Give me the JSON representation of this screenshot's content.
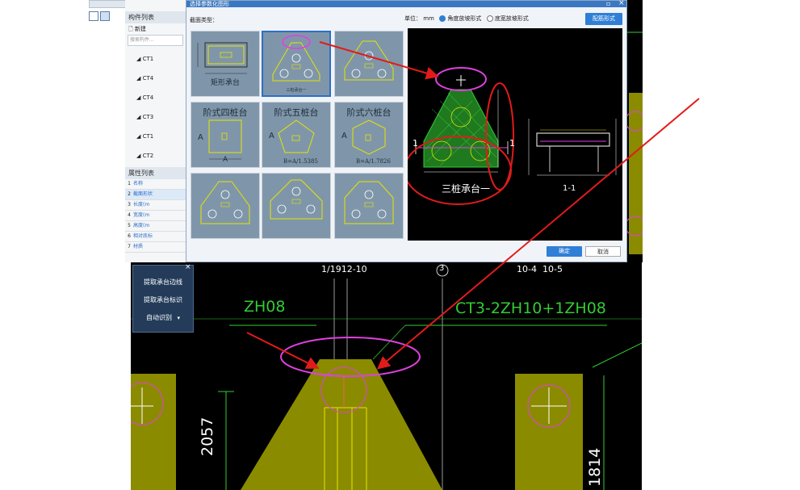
{
  "dialog": {
    "title": "选择参数化图形",
    "section_label": "截面类型：",
    "unit_label": "单位：",
    "unit_value": "mm",
    "radio_corner": "角度放坡形式",
    "radio_width": "底宽放坡形式",
    "ok_button": "确定",
    "cancel_button": "取消",
    "config_button": "配筋形式",
    "thumbnails": [
      {
        "label": "矩形承台"
      },
      {
        "label": "三桩承台一"
      },
      {
        "label": ""
      },
      {
        "label": "阶式四桩台"
      },
      {
        "label": "阶式五桩台"
      },
      {
        "label": "阶式六桩台"
      },
      {
        "label": ""
      },
      {
        "label": ""
      },
      {
        "label": ""
      }
    ],
    "thumb_dims": {
      "a": "A",
      "b": "B",
      "pent": "B=A/1.5385",
      "hex": "B=A/1.7826"
    },
    "preview_caption": "三桩承台一",
    "section_caption": "1-1",
    "preview_marks": [
      "1",
      "1"
    ]
  },
  "side_panel": {
    "header": "构件列表",
    "new_label": "新建",
    "search_placeholder": "搜索构件...",
    "items": [
      "CT1",
      "CT4",
      "CT4",
      "CT3",
      "CT1",
      "CT2"
    ],
    "props_header": "属性列表",
    "props": [
      {
        "n": "1",
        "label": "名称"
      },
      {
        "n": "2",
        "label": "截面形状"
      },
      {
        "n": "3",
        "label": "长度(m"
      },
      {
        "n": "4",
        "label": "宽度(m"
      },
      {
        "n": "5",
        "label": "高度(m"
      },
      {
        "n": "6",
        "label": "相对底标"
      },
      {
        "n": "7",
        "label": "材质"
      }
    ]
  },
  "float_panel": {
    "buttons": [
      "提取承台边线",
      "提取承台标识",
      "自动识别"
    ]
  },
  "cad": {
    "axis_labels": [
      "1/1912-10",
      "3",
      "10-4",
      "10-5"
    ],
    "label_zh08": "ZH08",
    "label_ct3": "CT3-2ZH10+1ZH08",
    "dim_2057": "2057",
    "dim_1814": "1814"
  },
  "colors": {
    "thumb_bg": "#7f96aa",
    "cad_bg": "#000000",
    "dialog_blue": "#2f7fd6",
    "annotation_red": "#e11b1b",
    "highlight_magenta": "#e040e0",
    "cad_green": "#33cc33",
    "footing_olive": "#8b8b00"
  }
}
